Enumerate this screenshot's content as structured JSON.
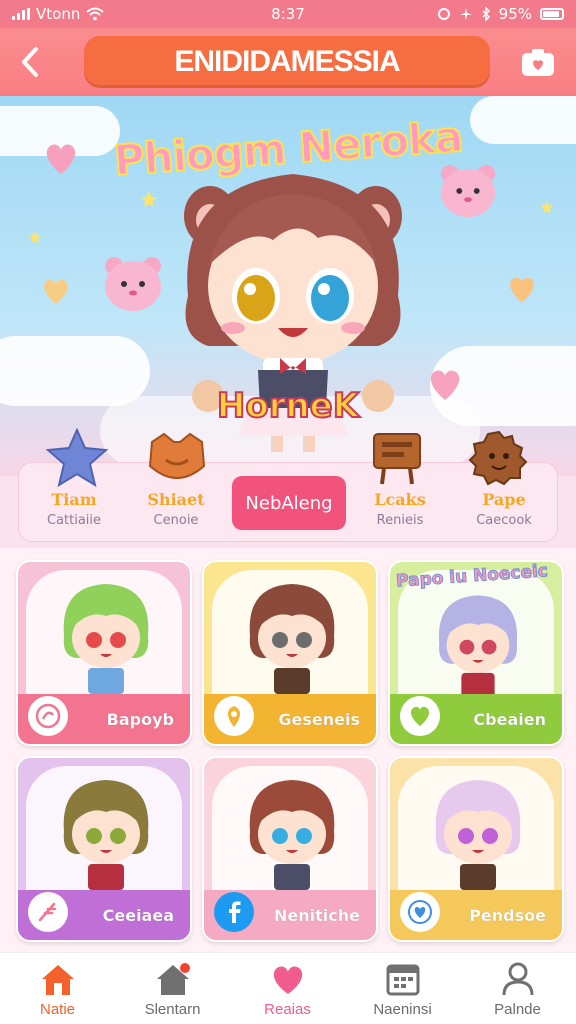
{
  "status_bar": {
    "carrier": "Vtonn",
    "time": "8:37",
    "battery": "95%"
  },
  "header": {
    "title": "ENIDIDAMESSIA",
    "back_icon": "chevron-left-icon",
    "camera_icon": "camera-icon"
  },
  "hero": {
    "title": "Phiogm Neroka",
    "name": "HorneK"
  },
  "categories": [
    {
      "label": "Tiam",
      "sub": "Cattiaiie",
      "icon": "star-icon",
      "color": "#6f86d6"
    },
    {
      "label": "Shiaet",
      "sub": "Cenoie",
      "icon": "cat-face-icon",
      "color": "#e07b39"
    },
    {
      "label": "NebAleng",
      "sub": "",
      "icon": "none",
      "color": "#f2537c"
    },
    {
      "label": "Lcaks",
      "sub": "Renieis",
      "icon": "shield-icon",
      "color": "#b5652e"
    },
    {
      "label": "Pape",
      "sub": "Caecook",
      "icon": "cookie-icon",
      "color": "#a0592c"
    }
  ],
  "cards": [
    {
      "label": "Bapoyb",
      "icon": "swirl-icon",
      "bg": "#f6c2d6",
      "bar": "#f3748f",
      "hair": "#8fd15a",
      "eyes": "#e54b4b"
    },
    {
      "label": "Geseneis",
      "icon": "location-pin-icon",
      "bg": "#fbe58f",
      "bar": "#f2b431",
      "hair": "#8b4a3a",
      "eyes": "#6d6d6d"
    },
    {
      "label": "Cbeaien",
      "icon": "heart-icon",
      "bg": "#d6ee9e",
      "bar": "#8fcb3d",
      "hair": "#b5b3e6",
      "eyes": "#d0485f",
      "banner": "Papo iu Noeceic"
    },
    {
      "label": "Ceeiaea",
      "icon": "feather-icon",
      "bg": "#e3c3ee",
      "bar": "#c06fd6",
      "hair": "#8a7b3c",
      "eyes": "#8fa83a"
    },
    {
      "label": "Nenitiche",
      "icon": "facebook-icon",
      "bg": "#fbd3dd",
      "bar": "#f5a9c2",
      "hair": "#9c4b3a",
      "eyes": "#38aee0"
    },
    {
      "label": "Pendsoe",
      "icon": "heart-icon",
      "bg": "#fbe2a8",
      "bar": "#f4c85a",
      "hair": "#e8c9ee",
      "eyes": "#c061d8"
    }
  ],
  "tabs": [
    {
      "label": "Natie",
      "icon": "home-icon",
      "color": "#f4612d",
      "active": true
    },
    {
      "label": "Slentarn",
      "icon": "house-notification-icon",
      "color": "#707070",
      "active": false
    },
    {
      "label": "Reaias",
      "icon": "heart-icon",
      "color": "#f05c8d",
      "active": false
    },
    {
      "label": "Naeninsi",
      "icon": "calendar-icon",
      "color": "#707070",
      "active": false
    },
    {
      "label": "Palnde",
      "icon": "person-icon",
      "color": "#707070",
      "active": false
    }
  ]
}
